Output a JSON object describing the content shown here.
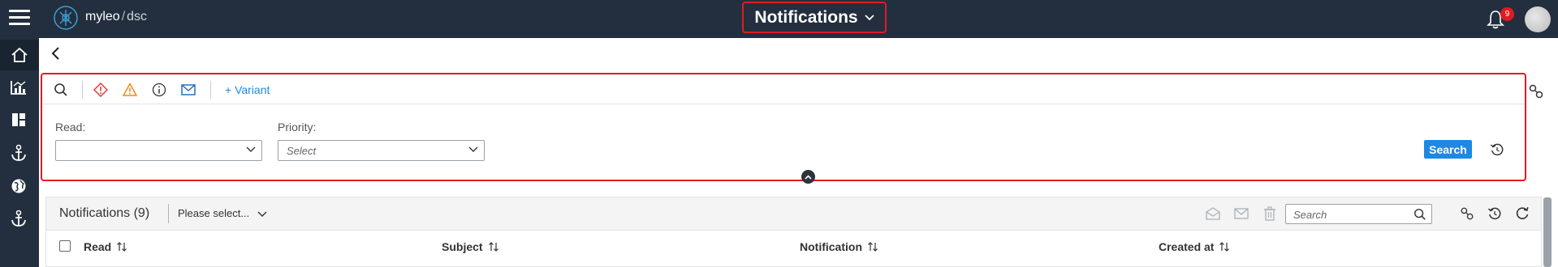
{
  "app": {
    "brand_name": "myleo",
    "brand_separator": "/",
    "brand_sub": "dsc",
    "page_title": "Notifications",
    "notification_count": "9"
  },
  "icons": {
    "menu": "hamburger-icon",
    "logo": "logo-icon",
    "title_dropdown": "chevron-down-icon",
    "bell": "bell-icon",
    "sidebar": [
      "home-icon",
      "chart-icon",
      "dashboard-icon",
      "anchor-icon",
      "globe-icon",
      "anchor-icon"
    ],
    "back": "chevron-left-icon",
    "filters": [
      "search-icon",
      "error-icon",
      "warning-icon",
      "info-icon",
      "mail-icon"
    ]
  },
  "filter": {
    "variant_label": "+ Variant",
    "read_label": "Read:",
    "read_value": "",
    "priority_label": "Priority:",
    "priority_placeholder": "Select",
    "search_button": "Search"
  },
  "table": {
    "title": "Notifications (9)",
    "select_label": "Please select...",
    "search_placeholder": "Search",
    "columns": [
      "Read",
      "Subject",
      "Notification",
      "Created at"
    ]
  },
  "colors": {
    "topbar": "#232f3e",
    "highlight": "#e11b22",
    "accent": "#1e88e5"
  }
}
